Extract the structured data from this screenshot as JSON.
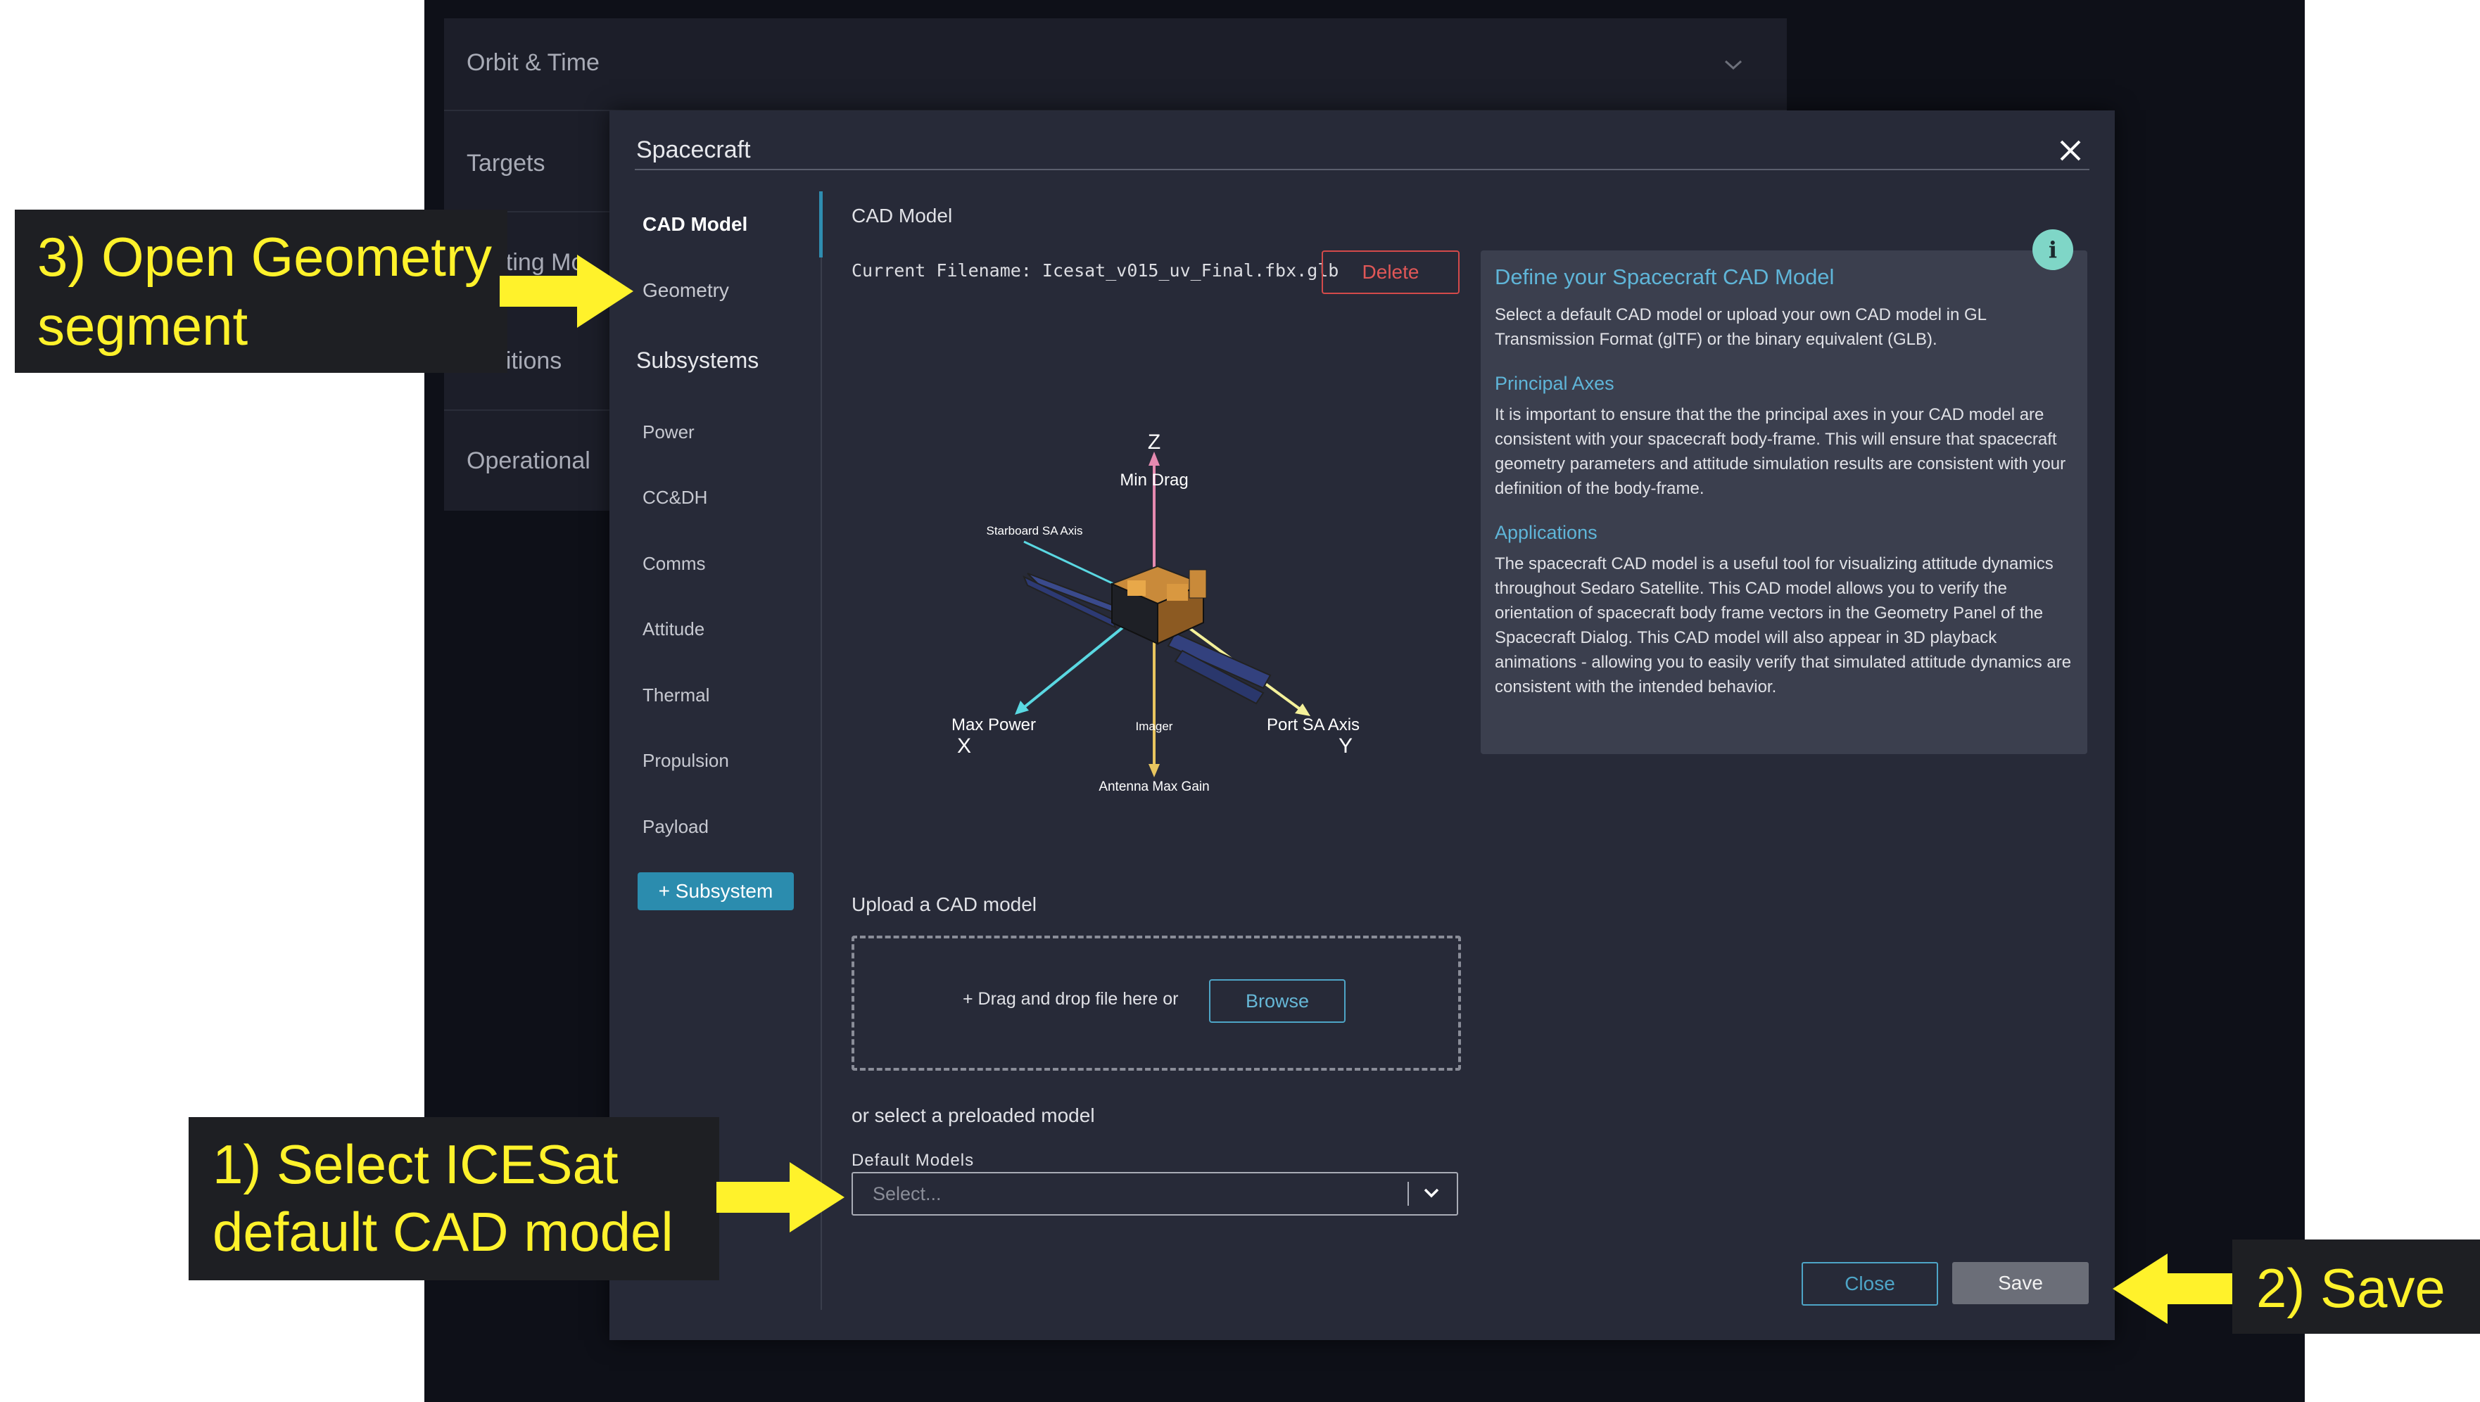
{
  "background_panel": {
    "items": [
      "Orbit & Time",
      "Targets",
      "nting Mo",
      "ditions",
      "Operational"
    ]
  },
  "dialog": {
    "title": "Spacecraft",
    "nav": {
      "cad_model": "CAD Model",
      "geometry": "Geometry",
      "subsystems_header": "Subsystems",
      "subsystems": [
        "Power",
        "CC&DH",
        "Comms",
        "Attitude",
        "Thermal",
        "Propulsion",
        "Payload"
      ],
      "add_subsystem": "+ Subsystem"
    },
    "main": {
      "section_title": "CAD Model",
      "current_filename": "Current Filename: Icesat_v015_uv_Final.fbx.glb",
      "delete_label": "Delete",
      "axes": {
        "z": "Z",
        "z_desc": "Min Drag",
        "starboard": "Starboard SA Axis",
        "x_desc": "Max Power",
        "x": "X",
        "imager": "Imager",
        "port": "Port SA Axis",
        "y": "Y",
        "antenna": "Antenna Max Gain"
      },
      "upload_title": "Upload a CAD model",
      "dropzone_text": "+ Drag and drop file here or",
      "browse_label": "Browse",
      "preloaded_text": "or select a preloaded model",
      "default_models_label": "Default Models",
      "select_placeholder": "Select..."
    },
    "info": {
      "title": "Define your Spacecraft CAD Model",
      "intro": "Select a default CAD model or upload your own CAD model in GL Transmission Format (glTF) or the binary equivalent (GLB).",
      "principal_title": "Principal Axes",
      "principal_text": "It is important to ensure that the the principal axes in your CAD model are consistent with your spacecraft body-frame. This will ensure that spacecraft geometry parameters and attitude simulation results are consistent with your definition of the body-frame.",
      "applications_title": "Applications",
      "applications_text": "The spacecraft CAD model is a useful tool for visualizing attitude dynamics throughout Sedaro Satellite. This CAD model allows you to verify the orientation of spacecraft body frame vectors in the Geometry Panel of the Spacecraft Dialog. This CAD model will also appear in 3D playback animations - allowing you to easily verify that simulated attitude dynamics are consistent with the intended behavior."
    },
    "footer": {
      "close_label": "Close",
      "save_label": "Save"
    }
  },
  "annotations": {
    "step3_line1": "3) Open Geometry",
    "step3_line2": "segment",
    "step1_line1": "1) Select ICESat",
    "step1_line2": "default CAD model",
    "step2": "2) Save"
  },
  "colors": {
    "app_bg": "#0e1018",
    "dialog_bg": "#272a38",
    "accent": "#2b8cae",
    "danger": "#d34a4a",
    "callout_text": "#fff22b",
    "arrow": "#fff22b"
  }
}
